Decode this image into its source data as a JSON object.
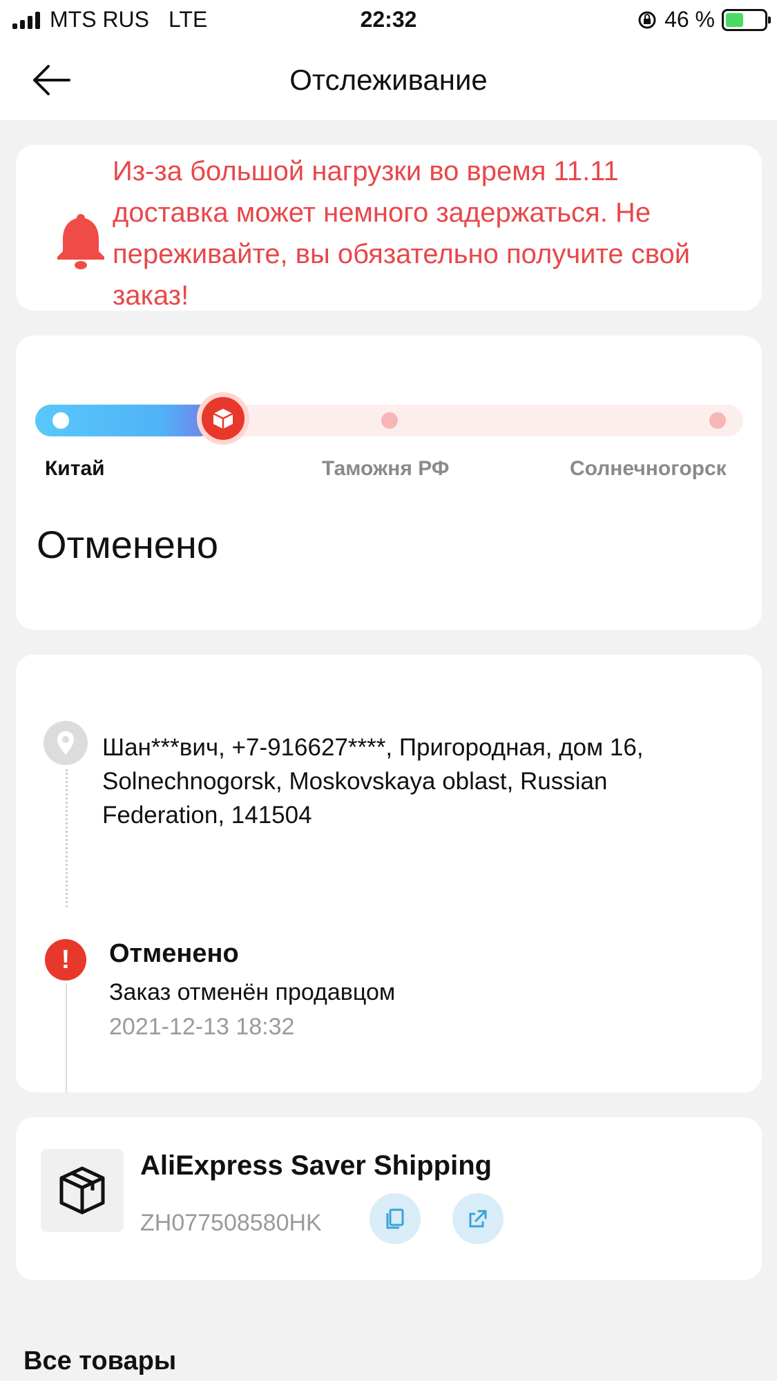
{
  "status_bar": {
    "carrier": "MTS RUS",
    "network": "LTE",
    "time": "22:32",
    "battery": "46 %"
  },
  "nav": {
    "title": "Отслеживание",
    "back_icon": "arrow-left-icon"
  },
  "notice": {
    "icon": "bell-icon",
    "text": "Из-за большой нагрузки во время 11.11 доставка может немного задержаться. Не переживайте, вы обязательно получите свой заказ!",
    "color": "#e8474a"
  },
  "progress": {
    "stages": [
      "Китай",
      "Таможня РФ",
      "Солнечногорск"
    ],
    "current_stage_index": 0,
    "status": "Отменено"
  },
  "timeline": {
    "address": "Шан***вич,  +7-916627****,  Пригородная, дом 16,  Solnechnogorsk,  Moskovskaya oblast,  Russian Federation,  141504",
    "event": {
      "title": "Отменено",
      "description": "Заказ отменён продавцом",
      "time": "2021-12-13 18:32"
    }
  },
  "shipping": {
    "carrier": "AliExpress Saver Shipping",
    "tracking_number": "ZH077508580HK",
    "copy_icon": "copy-icon",
    "open_icon": "external-link-icon"
  },
  "section": {
    "title": "Все товары"
  },
  "colors": {
    "accent_red": "#e8382c",
    "progress_blue": "#5ac8fa",
    "button_bg": "#d8edf7"
  }
}
